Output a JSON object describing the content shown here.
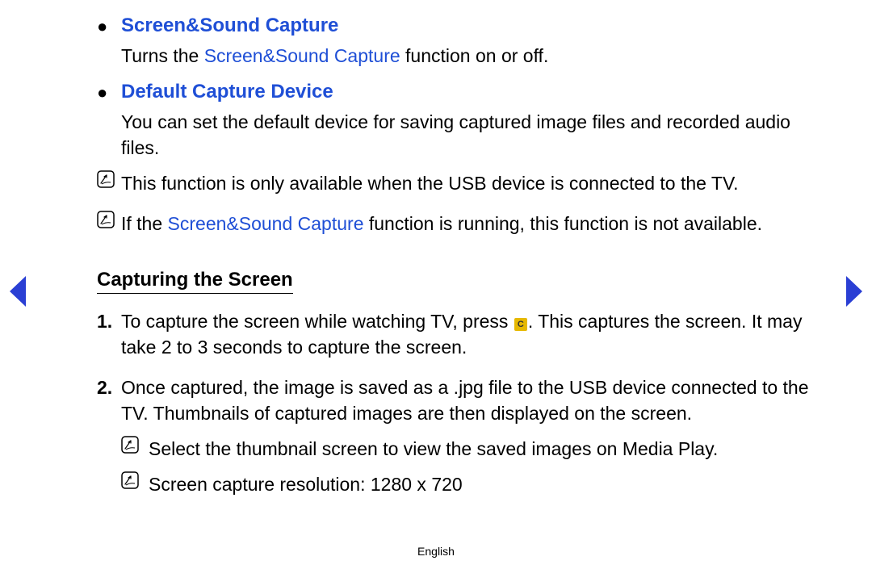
{
  "bullet1": {
    "title": "Screen&Sound Capture",
    "desc_a": "Turns the ",
    "desc_link": "Screen&Sound Capture",
    "desc_b": " function on or off."
  },
  "bullet2": {
    "title": "Default Capture Device",
    "desc": "You can set the default device for saving captured image files and recorded audio files."
  },
  "note1": "This function is only available when the USB device is connected to the TV.",
  "note2": {
    "a": "If the ",
    "link": "Screen&Sound Capture",
    "b": " function is running, this function is not available."
  },
  "subheading": "Capturing the Screen",
  "step1": {
    "marker": "1.",
    "a": "To capture the screen while watching TV, press ",
    "btn": "C",
    "b": ". This captures the screen. It may take 2 to 3 seconds to capture the screen."
  },
  "step2": {
    "marker": "2.",
    "text": "Once captured, the image is saved as a .jpg file to the USB device connected to the TV. Thumbnails of captured images are then displayed on the screen."
  },
  "subnote1": "Select the thumbnail screen to view the saved images on Media Play.",
  "subnote2": "Screen capture resolution: 1280 x 720",
  "footer": "English"
}
